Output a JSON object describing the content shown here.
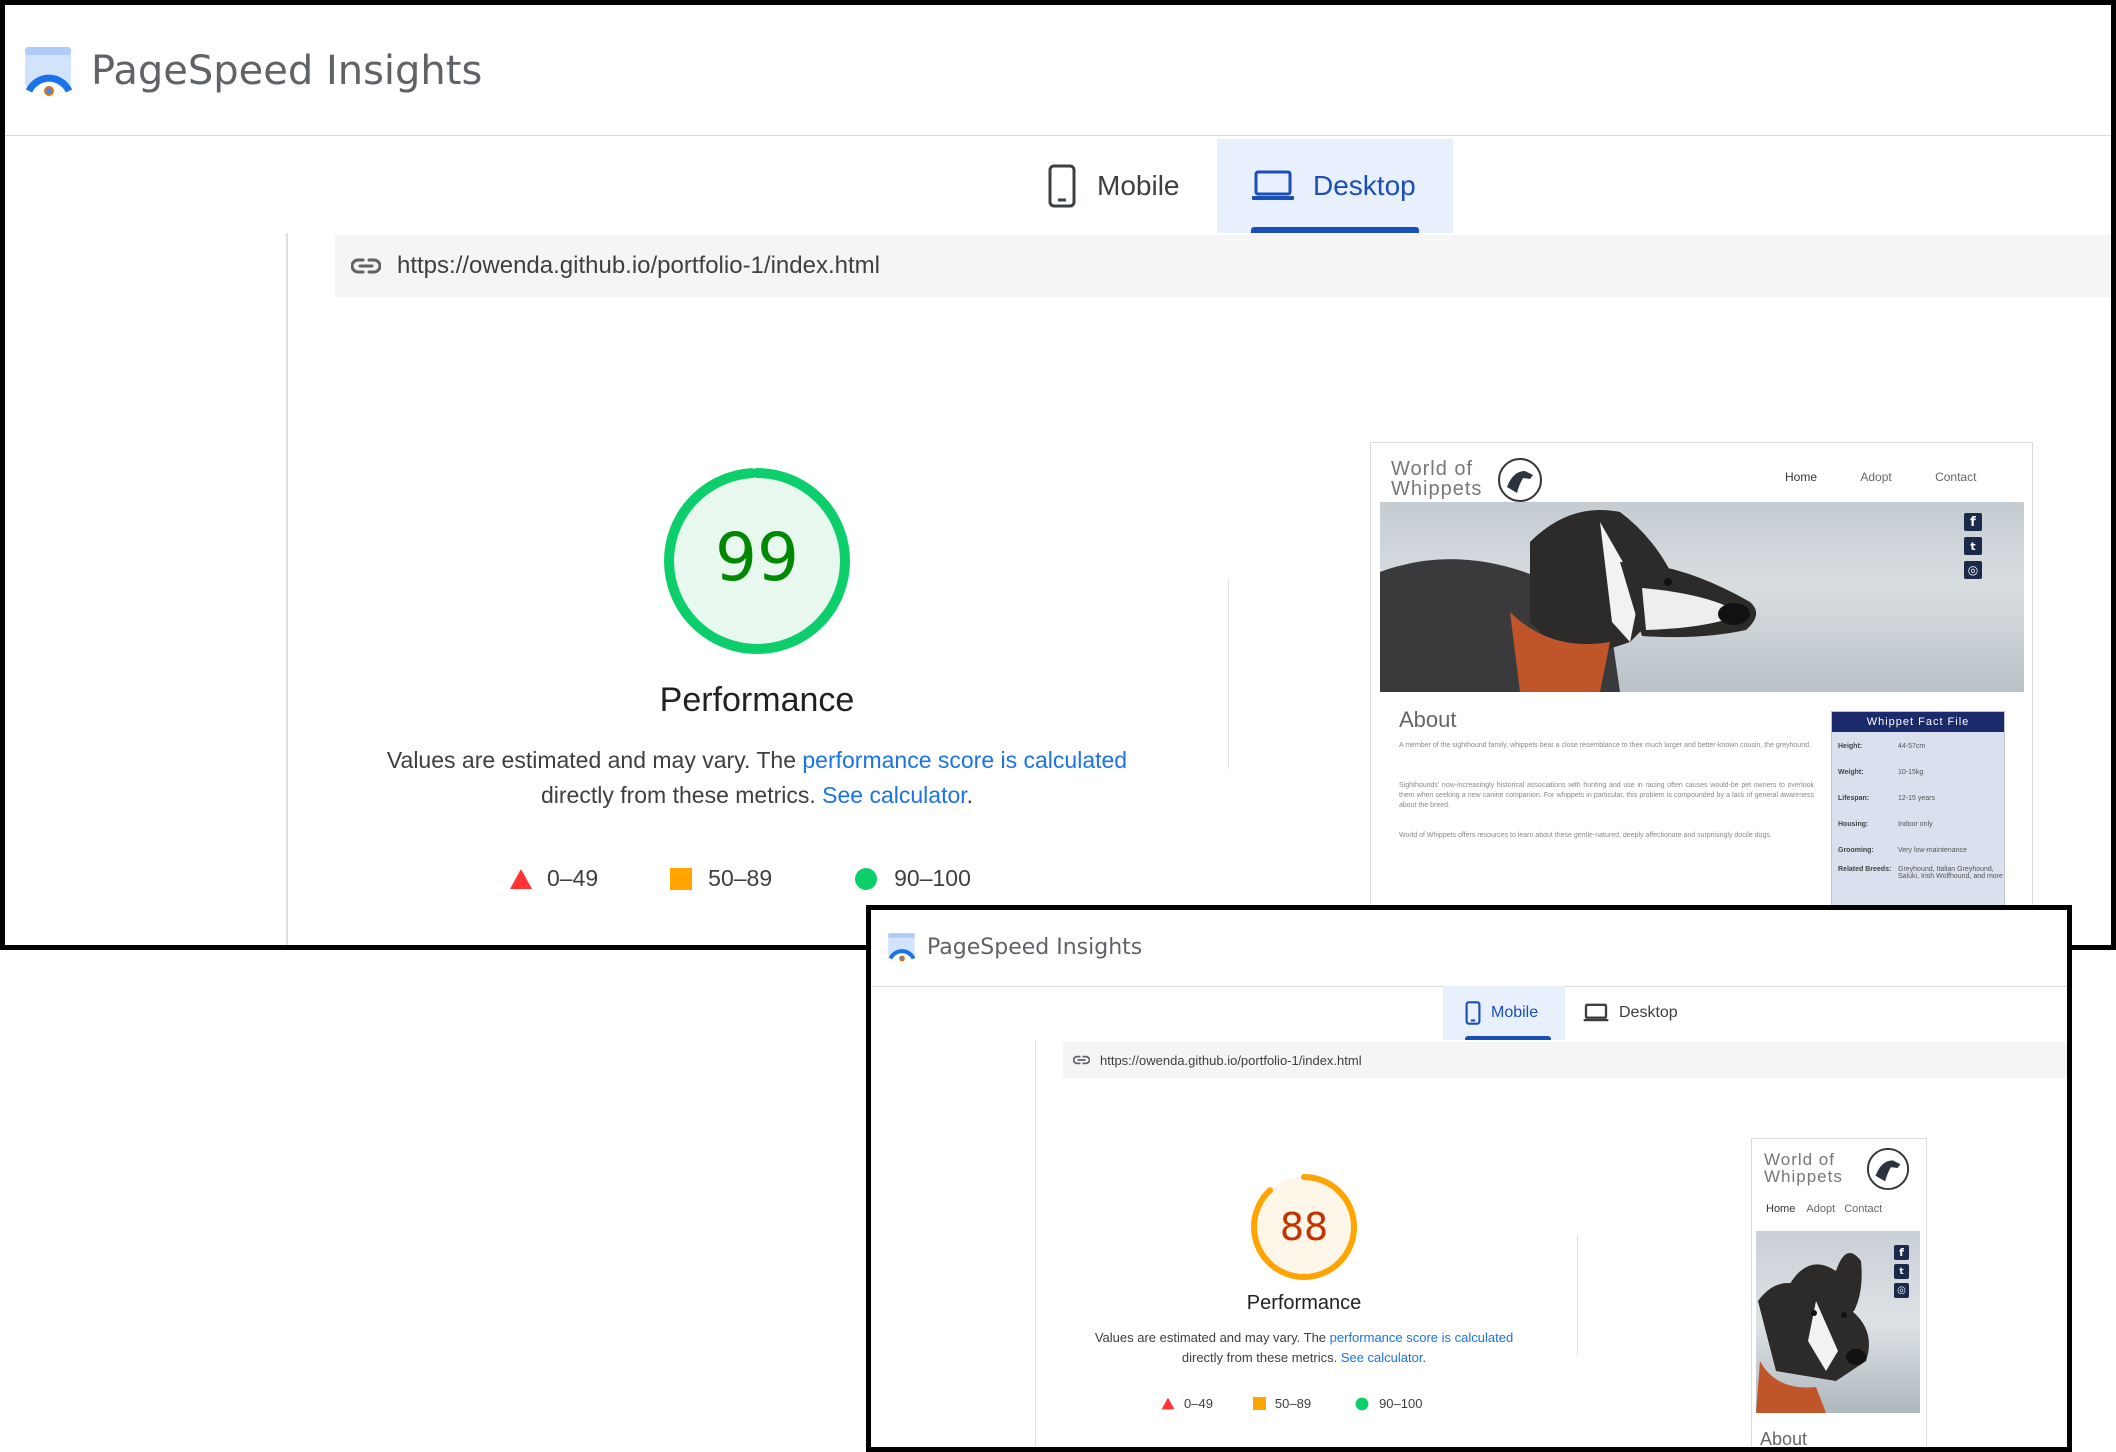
{
  "app": {
    "title": "PageSpeed Insights"
  },
  "tabs": {
    "mobile": "Mobile",
    "desktop": "Desktop"
  },
  "url": "https://owenda.github.io/portfolio-1/index.html",
  "report": {
    "title": "Performance",
    "desc_prefix": "Values are estimated and may vary. The ",
    "desc_link1": "performance score is calculated",
    "desc_middle": "directly from these metrics. ",
    "desc_link2": "See calculator",
    "desc_suffix": ".",
    "legend": {
      "fail": "0–49",
      "average": "50–89",
      "pass": "90–100"
    }
  },
  "desktop_view": {
    "active_tab": "Desktop",
    "score": "99",
    "score_value": 99,
    "score_color": "#0cce6b",
    "score_text_color": "#008800",
    "score_bg": "#e8f8ee"
  },
  "mobile_view": {
    "active_tab": "Mobile",
    "score": "88",
    "score_value": 88,
    "score_color": "#ffa400",
    "score_text_color": "#c33300",
    "score_bg": "#fff6ea"
  },
  "site_preview": {
    "logo_line1": "World of",
    "logo_line2": "Whippets",
    "nav": [
      "Home",
      "Adopt",
      "Contact"
    ],
    "social": [
      "f",
      "t",
      "◎"
    ],
    "about_heading": "About",
    "about_paragraphs": [
      "A member of the sighthound family, whippets bear a close resemblance to their much larger and better-known cousin, the greyhound.",
      "Sighthounds' now-increasingly historical associations with hunting and use in racing often causes would-be pet owners to overlook them when seeking a new canine companion. For whippets in particular, this problem is compounded by a lack of general awareness about the breed.",
      "World of Whippets offers resources to learn about these gentle-natured, deeply affectionate and surprisingly docile dogs."
    ],
    "fact_file_title": "Whippet Fact File",
    "facts": [
      {
        "k": "Height:",
        "v": "44-57cm"
      },
      {
        "k": "Weight:",
        "v": "10-15kg"
      },
      {
        "k": "Lifespan:",
        "v": "12-15 years"
      },
      {
        "k": "Housing:",
        "v": "Indoor only"
      },
      {
        "k": "Grooming:",
        "v": "Very low-maintenance"
      },
      {
        "k": "Related Breeds:",
        "v": "Greyhound, Italian Greyhound, Saluki, Irish Wolfhound, and more"
      }
    ]
  },
  "colors": {
    "link": "#1a73e8",
    "tab_active": "#1a4fb8",
    "fail": "#ff3333",
    "average": "#ffa400",
    "pass": "#0cce6b"
  }
}
